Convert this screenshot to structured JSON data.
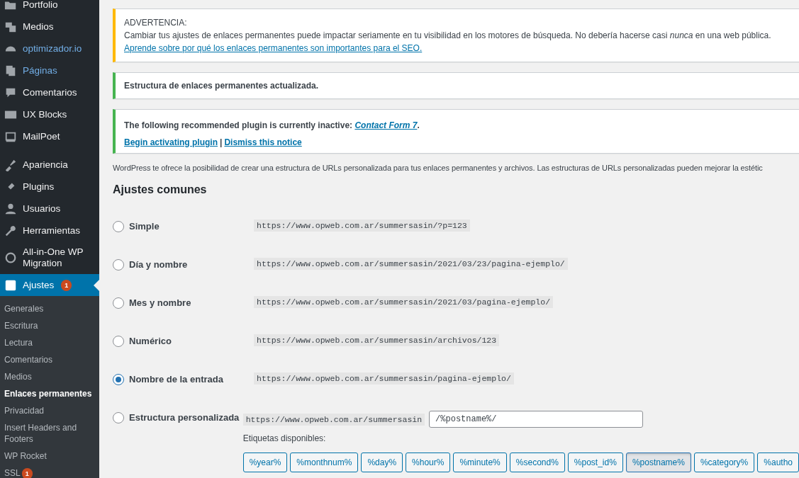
{
  "sidebar": {
    "menu": [
      {
        "label": "Portfolio",
        "accent": false,
        "selected": false
      },
      {
        "label": "Medios",
        "accent": false,
        "selected": false
      },
      {
        "label": "optimizador.io",
        "accent": true,
        "selected": false
      },
      {
        "label": "Páginas",
        "accent": true,
        "selected": false
      },
      {
        "label": "Comentarios",
        "accent": false,
        "selected": false
      },
      {
        "label": "UX Blocks",
        "accent": false,
        "selected": false
      },
      {
        "label": "MailPoet",
        "accent": false,
        "selected": false
      },
      {
        "label": "Apariencia",
        "accent": false,
        "selected": false
      },
      {
        "label": "Plugins",
        "accent": false,
        "selected": false
      },
      {
        "label": "Usuarios",
        "accent": false,
        "selected": false
      },
      {
        "label": "Herramientas",
        "accent": false,
        "selected": false
      },
      {
        "label": "All-in-One WP Migration",
        "accent": false,
        "selected": false
      },
      {
        "label": "Ajustes",
        "accent": false,
        "selected": true,
        "badge": "1"
      }
    ],
    "submenu": [
      {
        "label": "Generales",
        "selected": false
      },
      {
        "label": "Escritura",
        "selected": false
      },
      {
        "label": "Lectura",
        "selected": false
      },
      {
        "label": "Comentarios",
        "selected": false
      },
      {
        "label": "Medios",
        "selected": false
      },
      {
        "label": "Enlaces permanentes",
        "selected": true
      },
      {
        "label": "Privacidad",
        "selected": false
      },
      {
        "label": "Insert Headers and Footers",
        "selected": false
      },
      {
        "label": "WP Rocket",
        "selected": false
      },
      {
        "label": "SSL",
        "selected": false,
        "badge": "1"
      }
    ]
  },
  "notices": [
    {
      "kind": "warning",
      "title": "ADVERTENCIA:",
      "text": "Cambiar tus ajustes de enlaces permanentes puede impactar seriamente en tu visibilidad en los motores de búsqueda. No debería hacerse casi *nunca* en una web pública.",
      "link": "Aprende sobre por qué los enlaces permanentes son importantes para el SEO."
    },
    {
      "kind": "success",
      "text": "Estructura de enlaces permanentes actualizada."
    },
    {
      "kind": "info",
      "text": "The following recommended plugin is currently inactive: ",
      "inline_link": "Contact Form 7",
      "text_after": ".",
      "actions": [
        "Begin activating plugin",
        "Dismiss this notice"
      ],
      "separator": "|"
    }
  ],
  "intro": "WordPress te ofrece la posibilidad de crear una estructura de URLs personalizada para tus enlaces permanentes y archivos. Las estructuras de URLs personalizadas pueden mejorar la estétic",
  "heading": "Ajustes comunes",
  "options": [
    {
      "kind": "preset",
      "label": "Simple",
      "url": "https://www.opweb.com.ar/summersasin/?p=123",
      "selected": false
    },
    {
      "kind": "preset",
      "label": "Día y nombre",
      "url": "https://www.opweb.com.ar/summersasin/2021/03/23/pagina-ejemplo/",
      "selected": false
    },
    {
      "kind": "preset",
      "label": "Mes y nombre",
      "url": "https://www.opweb.com.ar/summersasin/2021/03/pagina-ejemplo/",
      "selected": false
    },
    {
      "kind": "preset",
      "label": "Numérico",
      "url": "https://www.opweb.com.ar/summersasin/archivos/123",
      "selected": false
    },
    {
      "kind": "preset",
      "label": "Nombre de la entrada",
      "url": "https://www.opweb.com.ar/summersasin/pagina-ejemplo/",
      "selected": true
    },
    {
      "kind": "custom",
      "label": "Estructura personalizada",
      "url": "https://www.opweb.com.ar/summersasin",
      "value": "/%postname%/",
      "selected": false
    }
  ],
  "tags_label": "Etiquetas disponibles:",
  "tags": [
    {
      "label": "%year%",
      "selected": false
    },
    {
      "label": "%monthnum%",
      "selected": false
    },
    {
      "label": "%day%",
      "selected": false
    },
    {
      "label": "%hour%",
      "selected": false
    },
    {
      "label": "%minute%",
      "selected": false
    },
    {
      "label": "%second%",
      "selected": false
    },
    {
      "label": "%post_id%",
      "selected": false
    },
    {
      "label": "%postname%",
      "selected": true
    },
    {
      "label": "%category%",
      "selected": false
    },
    {
      "label": "%autho",
      "selected": false
    }
  ]
}
